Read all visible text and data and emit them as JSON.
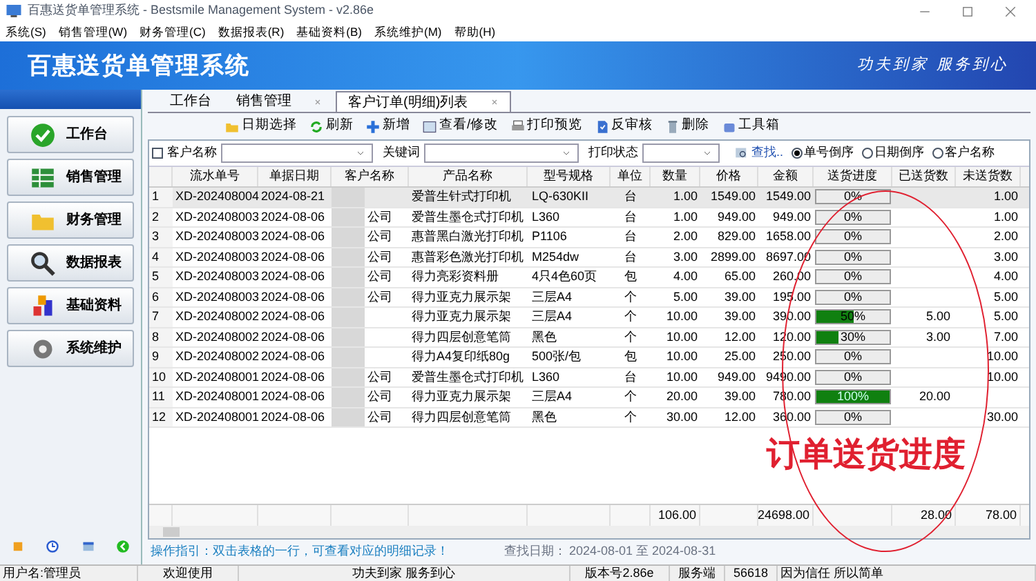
{
  "window": {
    "title": "百惠送货单管理系统 - Bestsmile Management System - v2.86e"
  },
  "menu": [
    "系统(S)",
    "销售管理(W)",
    "财务管理(C)",
    "数据报表(R)",
    "基础资料(B)",
    "系统维护(M)",
    "帮助(H)"
  ],
  "banner": {
    "title": "百惠送货单管理系统",
    "slogan": "功夫到家 服务到心"
  },
  "sidebar": {
    "items": [
      {
        "label": "工作台"
      },
      {
        "label": "销售管理"
      },
      {
        "label": "财务管理"
      },
      {
        "label": "数据报表"
      },
      {
        "label": "基础资料"
      },
      {
        "label": "系统维护"
      }
    ]
  },
  "tabs": [
    {
      "label": "工作台",
      "selected": false,
      "closable": false
    },
    {
      "label": "销售管理",
      "selected": false,
      "closable": true
    },
    {
      "label": "客户订单(明细)列表",
      "selected": true,
      "closable": true
    }
  ],
  "toolbar": [
    "日期选择",
    "刷新",
    "新增",
    "查看/修改",
    "打印预览",
    "反审核",
    "删除",
    "工具箱"
  ],
  "filters": {
    "customer_label": "客户名称",
    "customer_checked": false,
    "keyword_label": "关键词",
    "print_label": "打印状态",
    "find": "查找..",
    "sort": [
      {
        "label": "单号倒序",
        "selected": true
      },
      {
        "label": "日期倒序",
        "selected": false
      },
      {
        "label": "客户名称",
        "selected": false
      }
    ]
  },
  "table": {
    "columns": [
      "流水单号",
      "单据日期",
      "客户名称",
      "产品名称",
      "型号规格",
      "单位",
      "数量",
      "价格",
      "金额",
      "送货进度",
      "已送货数",
      "未送货数"
    ],
    "rows": [
      {
        "no": "1",
        "order": "XD-202408004",
        "date": "2024-08-21",
        "customer": "",
        "product": "爱普生针式打印机",
        "model": "LQ-630KII",
        "unit": "台",
        "qty": "1.00",
        "price": "1549.00",
        "amount": "1549.00",
        "progress": "0%",
        "level": 0,
        "sent": "",
        "remaining": "1.00",
        "selected": true
      },
      {
        "no": "2",
        "order": "XD-202408003",
        "date": "2024-08-06",
        "customer": "公司",
        "product": "爱普生墨仓式打印机",
        "model": "L360",
        "unit": "台",
        "qty": "1.00",
        "price": "949.00",
        "amount": "949.00",
        "progress": "0%",
        "level": 0,
        "sent": "",
        "remaining": "1.00",
        "selected": false
      },
      {
        "no": "3",
        "order": "XD-202408003",
        "date": "2024-08-06",
        "customer": "公司",
        "product": "惠普黑白激光打印机",
        "model": "P1106",
        "unit": "台",
        "qty": "2.00",
        "price": "829.00",
        "amount": "1658.00",
        "progress": "0%",
        "level": 0,
        "sent": "",
        "remaining": "2.00",
        "selected": false
      },
      {
        "no": "4",
        "order": "XD-202408003",
        "date": "2024-08-06",
        "customer": "公司",
        "product": "惠普彩色激光打印机",
        "model": "M254dw",
        "unit": "台",
        "qty": "3.00",
        "price": "2899.00",
        "amount": "8697.00",
        "progress": "0%",
        "level": 0,
        "sent": "",
        "remaining": "3.00",
        "selected": false
      },
      {
        "no": "5",
        "order": "XD-202408003",
        "date": "2024-08-06",
        "customer": "公司",
        "product": "得力亮彩资料册",
        "model": "4只4色60页",
        "unit": "包",
        "qty": "4.00",
        "price": "65.00",
        "amount": "260.00",
        "progress": "0%",
        "level": 0,
        "sent": "",
        "remaining": "4.00",
        "selected": false
      },
      {
        "no": "6",
        "order": "XD-202408003",
        "date": "2024-08-06",
        "customer": "公司",
        "product": "得力亚克力展示架",
        "model": "三层A4",
        "unit": "个",
        "qty": "5.00",
        "price": "39.00",
        "amount": "195.00",
        "progress": "0%",
        "level": 0,
        "sent": "",
        "remaining": "5.00",
        "selected": false
      },
      {
        "no": "7",
        "order": "XD-202408002",
        "date": "2024-08-06",
        "customer": "",
        "product": "得力亚克力展示架",
        "model": "三层A4",
        "unit": "个",
        "qty": "10.00",
        "price": "39.00",
        "amount": "390.00",
        "progress": "50%",
        "level": 0.5,
        "sent": "5.00",
        "remaining": "5.00",
        "selected": false
      },
      {
        "no": "8",
        "order": "XD-202408002",
        "date": "2024-08-06",
        "customer": "",
        "product": "得力四层创意笔筒",
        "model": "黑色",
        "unit": "个",
        "qty": "10.00",
        "price": "12.00",
        "amount": "120.00",
        "progress": "30%",
        "level": 0.3,
        "sent": "3.00",
        "remaining": "7.00",
        "selected": false
      },
      {
        "no": "9",
        "order": "XD-202408002",
        "date": "2024-08-06",
        "customer": "",
        "product": "得力A4复印纸80g",
        "model": "500张/包",
        "unit": "包",
        "qty": "10.00",
        "price": "25.00",
        "amount": "250.00",
        "progress": "0%",
        "level": 0,
        "sent": "",
        "remaining": "10.00",
        "selected": false
      },
      {
        "no": "10",
        "order": "XD-202408001",
        "date": "2024-08-06",
        "customer": "公司",
        "product": "爱普生墨仓式打印机",
        "model": "L360",
        "unit": "台",
        "qty": "10.00",
        "price": "949.00",
        "amount": "9490.00",
        "progress": "0%",
        "level": 0,
        "sent": "",
        "remaining": "10.00",
        "selected": false
      },
      {
        "no": "11",
        "order": "XD-202408001",
        "date": "2024-08-06",
        "customer": "公司",
        "product": "得力亚克力展示架",
        "model": "三层A4",
        "unit": "个",
        "qty": "20.00",
        "price": "39.00",
        "amount": "780.00",
        "progress": "100%",
        "level": 1,
        "sent": "20.00",
        "remaining": "",
        "selected": false
      },
      {
        "no": "12",
        "order": "XD-202408001",
        "date": "2024-08-06",
        "customer": "公司",
        "product": "得力四层创意笔筒",
        "model": "黑色",
        "unit": "个",
        "qty": "30.00",
        "price": "12.00",
        "amount": "360.00",
        "progress": "0%",
        "level": 0,
        "sent": "",
        "remaining": "30.00",
        "selected": false
      }
    ],
    "totals": {
      "qty": "106.00",
      "amount": "24698.00",
      "sent": "28.00",
      "remaining": "78.00"
    }
  },
  "annotation": "订单送货进度",
  "guide": {
    "text": "操作指引：双击表格的一行，可查看对应的明细记录！",
    "date_label": "查找日期：",
    "date_range": "2024-08-01 至 2024-08-31"
  },
  "status_bar": [
    "用户名:管理员",
    "欢迎使用",
    "功夫到家 服务到心",
    "版本号2.86e",
    "服务端",
    "56618",
    "因为信任 所以简单"
  ]
}
